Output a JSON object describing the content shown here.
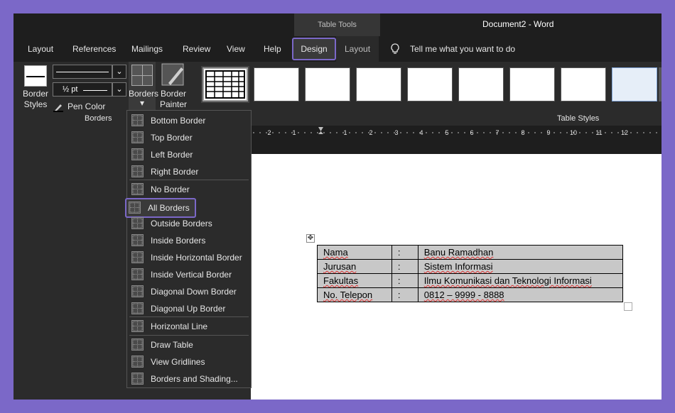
{
  "app": {
    "table_tools_label": "Table Tools",
    "document_title": "Document2  -  Word"
  },
  "tabs": [
    {
      "label": "Layout"
    },
    {
      "label": "References"
    },
    {
      "label": "Mailings"
    },
    {
      "label": "Review"
    },
    {
      "label": "View"
    },
    {
      "label": "Help"
    },
    {
      "label": "Design"
    },
    {
      "label": "Layout"
    }
  ],
  "tell_me": "Tell me what you want to do",
  "ribbon": {
    "border_styles_label_1": "Border",
    "border_styles_label_2": "Styles",
    "pen_weight": "½ pt",
    "pen_color_label": "Pen Color",
    "borders_label": "Borders",
    "border_painter_label_1": "Border",
    "border_painter_label_2": "Painter",
    "borders_group_name": "Borders",
    "table_styles_group_name": "Table Styles"
  },
  "ruler_labels": [
    "2",
    "1",
    "1",
    "2",
    "3",
    "4",
    "5",
    "6",
    "7",
    "8",
    "9",
    "10",
    "11",
    "12"
  ],
  "menu": {
    "items": [
      {
        "label": "Bottom Border",
        "icon": "bottom-border-icon"
      },
      {
        "label": "Top Border",
        "icon": "top-border-icon"
      },
      {
        "label": "Left Border",
        "icon": "left-border-icon"
      },
      {
        "label": "Right Border",
        "icon": "right-border-icon"
      },
      {
        "label": "No Border",
        "icon": "no-border-icon"
      },
      {
        "label": "All Borders",
        "icon": "all-borders-icon"
      },
      {
        "label": "Outside Borders",
        "icon": "outside-borders-icon"
      },
      {
        "label": "Inside Borders",
        "icon": "inside-borders-icon"
      },
      {
        "label": "Inside Horizontal Border",
        "icon": "inside-horizontal-border-icon"
      },
      {
        "label": "Inside Vertical Border",
        "icon": "inside-vertical-border-icon"
      },
      {
        "label": "Diagonal Down Border",
        "icon": "diagonal-down-border-icon"
      },
      {
        "label": "Diagonal Up Border",
        "icon": "diagonal-up-border-icon"
      },
      {
        "label": "Horizontal Line",
        "icon": "horizontal-line-icon"
      },
      {
        "label": "Draw Table",
        "icon": "draw-table-icon"
      },
      {
        "label": "View Gridlines",
        "icon": "view-gridlines-icon"
      },
      {
        "label": "Borders and Shading...",
        "icon": "borders-shading-icon"
      }
    ]
  },
  "table": {
    "rows": [
      [
        "Nama",
        ":",
        "Banu Ramadhan"
      ],
      [
        "Jurusan",
        ":",
        "Sistem Informasi"
      ],
      [
        "Fakultas",
        ":",
        "Ilmu Komunikasi dan Teknologi Informasi"
      ],
      [
        "No. Telepon",
        ":",
        "0812 – 9999 - 8888"
      ]
    ]
  },
  "colors": {
    "accent": "#7b68c8",
    "ribbon_bg": "#2b2b2b",
    "titlebar_bg": "#1e1e1e",
    "cell_bg": "#c8c8c8"
  }
}
